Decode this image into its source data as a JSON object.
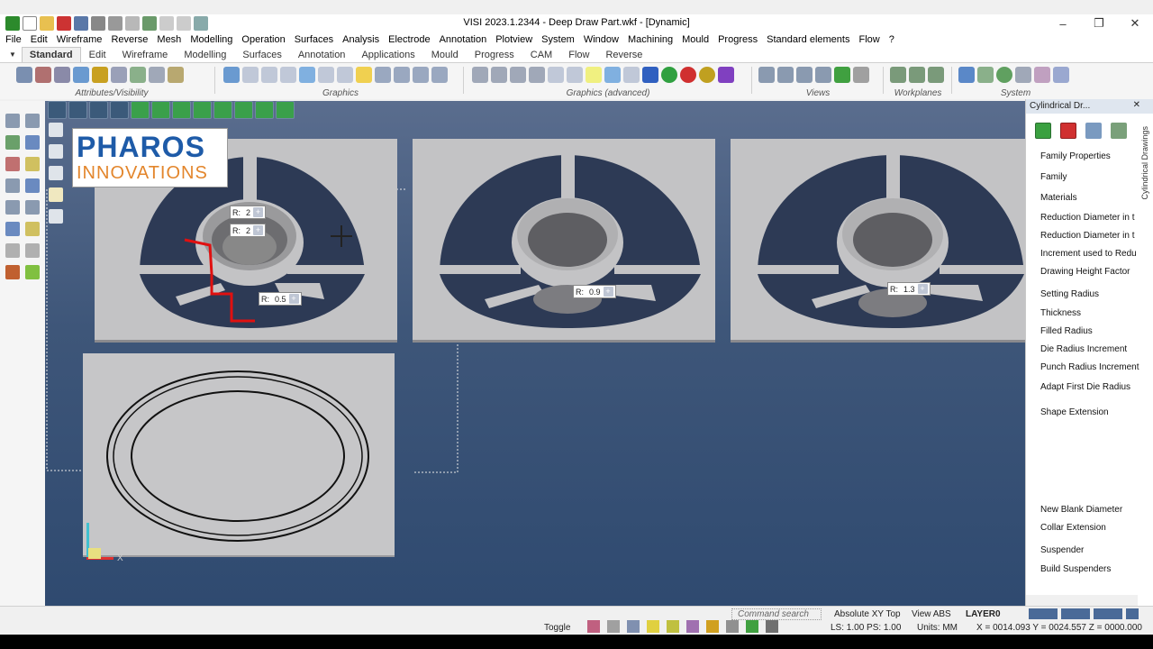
{
  "window": {
    "title": "VISI 2023.1.2344 - Deep Draw Part.wkf - [Dynamic]",
    "controls": [
      "–",
      "❐",
      "✕"
    ]
  },
  "menu": [
    "File",
    "Edit",
    "Wireframe",
    "Reverse",
    "Mesh",
    "Modelling",
    "Operation",
    "Surfaces",
    "Analysis",
    "Electrode",
    "Annotation",
    "Plotview",
    "System",
    "Window",
    "Machining",
    "Mould",
    "Progress",
    "Standard elements",
    "Flow",
    "?"
  ],
  "tabs": [
    "Standard",
    "Edit",
    "Wireframe",
    "Modelling",
    "Surfaces",
    "Annotation",
    "Applications",
    "Mould",
    "Progress",
    "CAM",
    "Flow",
    "Reverse"
  ],
  "active_tab": "Standard",
  "ribbon_groups": [
    "Attributes/Visibility",
    "Graphics",
    "Graphics (advanced)",
    "Views",
    "Workplanes",
    "System"
  ],
  "logo": {
    "line1": "PHAROS",
    "line2": "INNOVATIONS"
  },
  "dimensions": [
    {
      "label": "R:",
      "value": "2"
    },
    {
      "label": "R:",
      "value": "2"
    },
    {
      "label": "R:",
      "value": "0.5"
    },
    {
      "label": "R:",
      "value": "0.9"
    },
    {
      "label": "R:",
      "value": "1.3"
    }
  ],
  "axis_label": "X",
  "panel": {
    "title": "Cylindrical Dr...",
    "vertical_title": "Cylindrical Drawings",
    "items": [
      "Family Properties",
      "Family",
      "Materials",
      "Reduction Diameter in t",
      "Reduction Diameter in t",
      "Increment used to Redu",
      "Drawing Height Factor",
      "Setting Radius",
      "Thickness",
      "Filled Radius",
      "Die Radius Increment",
      "Punch Radius Increment",
      "Adapt First Die Radius",
      "Shape Extension",
      "New Blank Diameter",
      "Collar Extension",
      "Suspender",
      "Build Suspenders"
    ]
  },
  "status": {
    "command_search": "Command search",
    "view_mode": "Absolute XY Top",
    "view_abs": "View ABS",
    "layer": "LAYER0",
    "toggle": "Toggle",
    "ls_ps": "LS: 1.00 PS: 1.00",
    "units": "Units: MM",
    "coords": "X = 0014.093 Y = 0024.557 Z = 0000.000"
  },
  "colors": {
    "accent": "#1e5ba8",
    "logo_orange": "#e3862c",
    "viewport_top": "#5a6d8e",
    "viewport_bottom": "#2f4a70",
    "plate": "#c3c3c5",
    "highlight_red": "#e01010"
  }
}
